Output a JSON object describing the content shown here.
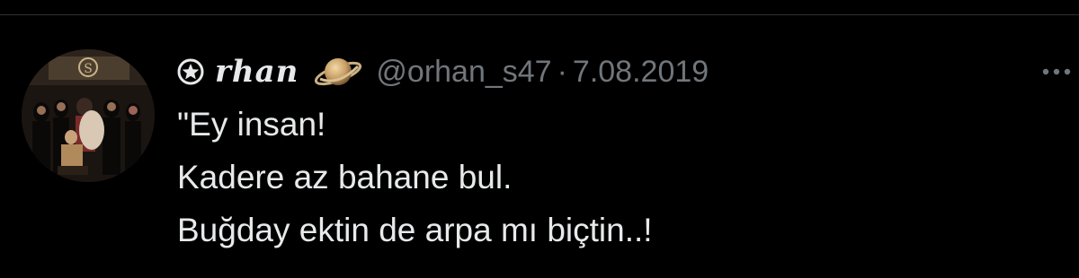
{
  "tweet": {
    "display_name": "✪ rhan",
    "name_text": "rhan",
    "handle": "@orhan_s47",
    "separator": "·",
    "date": "7.08.2019",
    "lines": [
      "\"Ey insan!",
      "Kadere az bahane bul.",
      "Buğday ektin de arpa mı biçtin..!"
    ]
  },
  "icons": {
    "name_prefix": "star-circle-icon",
    "name_suffix": "saturn-planet-icon",
    "menu": "more-horizontal-icon"
  },
  "colors": {
    "background": "#000000",
    "text": "#e7e9ea",
    "secondary_text": "#71767b",
    "divider": "#2f3336"
  }
}
